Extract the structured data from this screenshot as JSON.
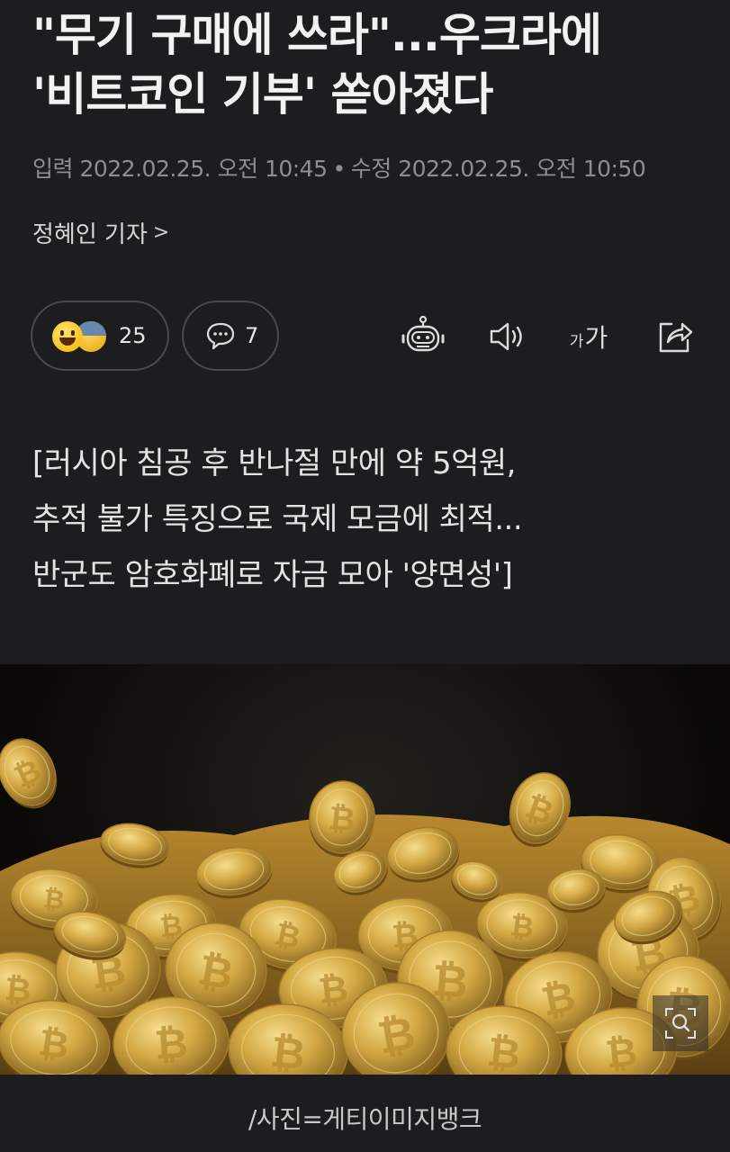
{
  "article": {
    "headline": {
      "line1": "\"무기 구매에 쓰라\"...우크라에",
      "line2": "'비트코인 기부' 쏟아졌다"
    },
    "meta": {
      "input_label": "입력",
      "input_time": "2022.02.25. 오전 10:45",
      "separator": "•",
      "edit_label": "수정",
      "edit_time": "2022.02.25. 오전 10:50"
    },
    "reporter": {
      "name": "정혜인 기자",
      "chevron": ">"
    },
    "reactions": {
      "count": "25",
      "emoji_icons": [
        "laughing-face-icon",
        "sad-sweat-face-icon"
      ]
    },
    "comments": {
      "count": "7",
      "icon": "speech-bubble-icon"
    },
    "toolbar": {
      "icons": [
        "robot-summary-icon",
        "speaker-icon",
        "font-size-icon",
        "share-icon"
      ],
      "font_small": "가",
      "font_big": "가"
    },
    "summary": {
      "line1": "[러시아 침공 후 반나절 만에 약 5억원,",
      "line2": "추적 불가 특징으로 국제 모금에 최적...",
      "line3": "반군도 암호화폐로 자금 모아 '양면성']"
    },
    "photo": {
      "subject": "gold-bitcoin-coins-pile",
      "zoom_icon": "magnify-icon"
    },
    "caption": "/사진=게티이미지뱅크"
  },
  "colors": {
    "background": "#1d1d1f",
    "text_primary": "#f2f2f2",
    "text_meta": "#8e8e92",
    "pill_border": "#4a4a4e",
    "coin_gold": "#d4a843"
  }
}
